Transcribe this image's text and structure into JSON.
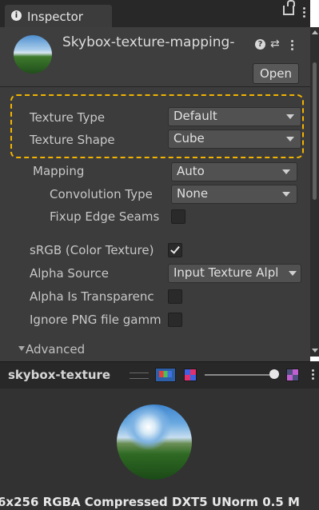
{
  "tab": {
    "title": "Inspector"
  },
  "header": {
    "asset_title": "Skybox-texture-mapping-",
    "help_glyph": "?",
    "preset_glyph": "⇄",
    "open_label": "Open"
  },
  "properties": {
    "texture_type": {
      "label": "Texture Type",
      "value": "Default"
    },
    "texture_shape": {
      "label": "Texture Shape",
      "value": "Cube"
    },
    "mapping": {
      "label": "Mapping",
      "value": "Auto"
    },
    "convolution_type": {
      "label": "Convolution Type",
      "value": "None"
    },
    "fixup_edge_seams": {
      "label": "Fixup Edge Seams",
      "checked": false
    },
    "srgb": {
      "label": "sRGB (Color Texture)",
      "checked": true
    },
    "alpha_source": {
      "label": "Alpha Source",
      "value": "Input Texture Alpl"
    },
    "alpha_is_transparency": {
      "label": "Alpha Is Transparenc",
      "checked": false
    },
    "ignore_png_gamma": {
      "label": "Ignore PNG file gamm",
      "checked": false
    },
    "advanced": {
      "label": "Advanced",
      "expanded": true
    }
  },
  "preview": {
    "title": "skybox-texture",
    "mip_level": 1.0,
    "info": "6x256  RGBA Compressed DXT5 UNorm  0.5 M"
  },
  "colors": {
    "panel": "#3c3c3c",
    "highlight": "#f2b400",
    "field": "#515151"
  }
}
